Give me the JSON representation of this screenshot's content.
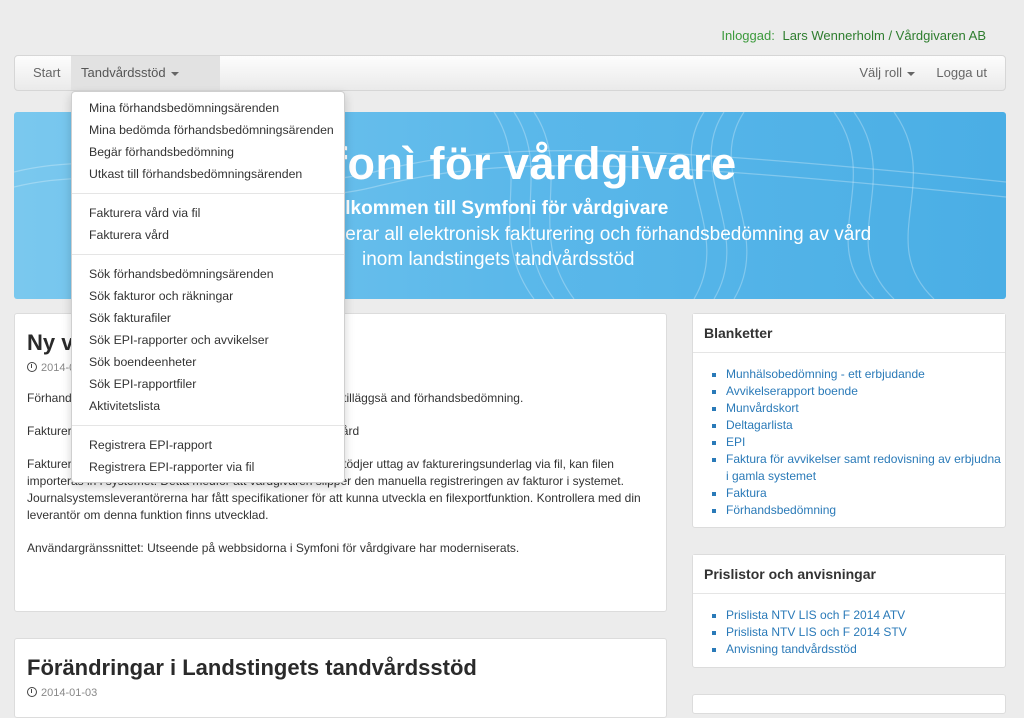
{
  "header": {
    "login_label": "Inloggad:",
    "login_user": "Lars Wennerholm / Vårdgivaren AB"
  },
  "nav": {
    "start": "Start",
    "tandvard": "Tandvårdsstöd",
    "valj_roll": "Välj roll",
    "logga_ut": "Logga ut"
  },
  "dropdown": {
    "groups": [
      [
        "Mina förhandsbedömningsärenden",
        "Mina bedömda förhandsbedömningsärenden",
        "Begär förhandsbedömning",
        "Utkast till förhandsbedömningsärenden"
      ],
      [
        "Fakturera vård via fil",
        "Fakturera vård"
      ],
      [
        "Sök förhandsbedömningsärenden",
        "Sök fakturor och räkningar",
        "Sök fakturafiler",
        "Sök EPI-rapporter och avvikelser",
        "Sök boendeenheter",
        "Sök EPI-rapportfiler",
        "Aktivitetslista"
      ],
      [
        "Registrera EPI-rapport",
        "Registrera EPI-rapporter via fil"
      ]
    ]
  },
  "banner": {
    "title": "fonì för vårdgivare",
    "line1": "ilkommen till Symfoni för vårdgivare",
    "line2": "terar all elektronisk fakturering och förhandsbedömning av vård",
    "line3": "inom landstingets tandvårdsstöd"
  },
  "news1": {
    "title": "Ny v                                                 givare",
    "date": "2014-0",
    "paragraphs": [
      "Förhand                                                    örhandsbedömningar samt möjlighet att registrera tilläggsä                                                    and förhandsbedömning.",
      "Fakturer                                                   et, så att en elektronisk faktura inkommer till tandvård",
      "Fakturering via fil: I de fall där vårdgivarens journalsystem stödjer uttag av faktureringsunderlag via fil, kan filen importeras in i systemet. Detta medför att vårdgivaren slipper den manuella registreringen av fakturor i systemet. Journalsystemsleverantörerna har fått specifikationer för att kunna utveckla en filexportfunktion. Kontrollera med din leverantör om denna funktion finns utvecklad.",
      "Användargränssnittet: Utseende på webbsidorna i Symfoni för vårdgivare har moderniserats."
    ]
  },
  "news2": {
    "title": "Förändringar i Landstingets tandvårdsstöd",
    "date": "2014-01-03"
  },
  "blanketter": {
    "title": "Blanketter",
    "items": [
      "Munhälsobedömning - ett erbjudande",
      "Avvikelserapport boende",
      "Munvårdskort",
      "Deltagarlista",
      "EPI",
      "Faktura för avvikelser samt redovisning av erbjudna i gamla systemet",
      "Faktura",
      "Förhandsbedömning"
    ]
  },
  "prislistor": {
    "title": "Prislistor och anvisningar",
    "items": [
      "Prislista NTV LIS och F 2014 ATV",
      "Prislista NTV LIS och F 2014 STV",
      "Anvisning tandvårdsstöd"
    ]
  }
}
